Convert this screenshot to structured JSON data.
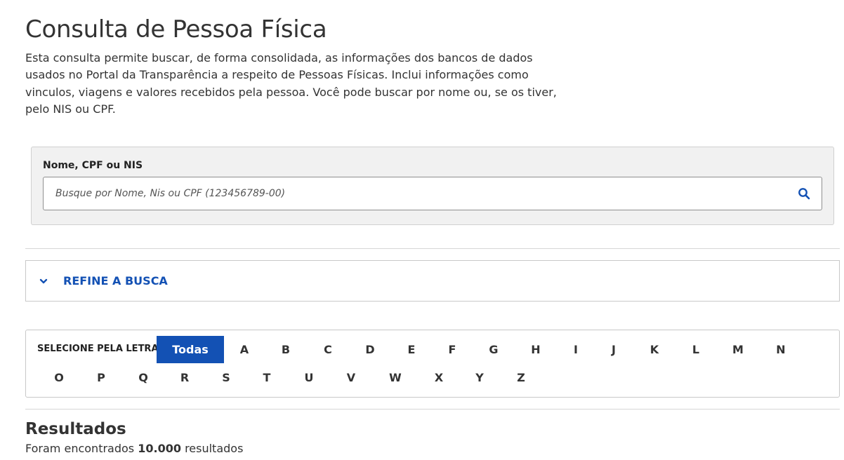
{
  "page": {
    "title": "Consulta de Pessoa Física",
    "description": "Esta consulta permite buscar, de forma consolidada, as informações dos bancos de dados usados no Portal da Transparência a respeito de Pessoas Físicas. Inclui informações como vinculos, viagens e valores recebidos pela pessoa. Você pode buscar por nome ou, se os tiver, pelo NIS ou CPF."
  },
  "search": {
    "label": "Nome, CPF ou NIS",
    "placeholder": "Busque por Nome, Nis ou CPF (123456789-00)",
    "value": "",
    "icon": "search-icon"
  },
  "refine": {
    "label": "REFINE A BUSCA",
    "icon": "chevron-down-icon"
  },
  "letters": {
    "label": "SELECIONE PELA LETRA:",
    "selected": "Todas",
    "row1": [
      "Todas",
      "A",
      "B",
      "C",
      "D",
      "E",
      "F",
      "G",
      "H",
      "I",
      "J",
      "K",
      "L",
      "M",
      "N"
    ],
    "row2": [
      "O",
      "P",
      "Q",
      "R",
      "S",
      "T",
      "U",
      "V",
      "W",
      "X",
      "Y",
      "Z"
    ]
  },
  "results": {
    "title": "Resultados",
    "prefix": "Foram encontrados",
    "count": "10.000",
    "suffix": "resultados"
  },
  "colors": {
    "primary": "#1351b4",
    "panel_bg": "#f1f1f1",
    "text": "#333333"
  }
}
